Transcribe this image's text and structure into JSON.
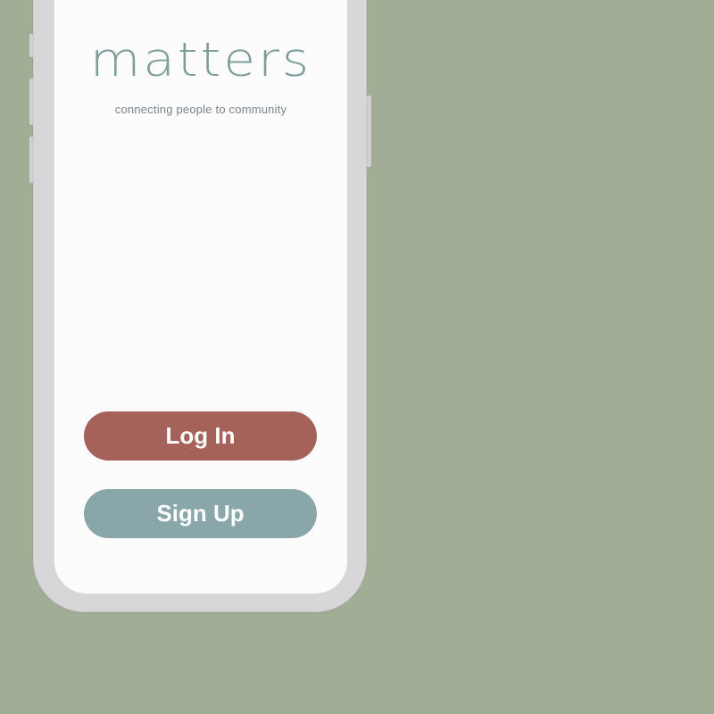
{
  "app": {
    "name": "matters",
    "tagline": "connecting people to community"
  },
  "actions": {
    "login_label": "Log In",
    "signup_label": "Sign Up"
  },
  "colors": {
    "background": "#a1ad95",
    "brand_text": "#7e9e9b",
    "login_button": "#a5625a",
    "signup_button": "#89a6a9"
  }
}
